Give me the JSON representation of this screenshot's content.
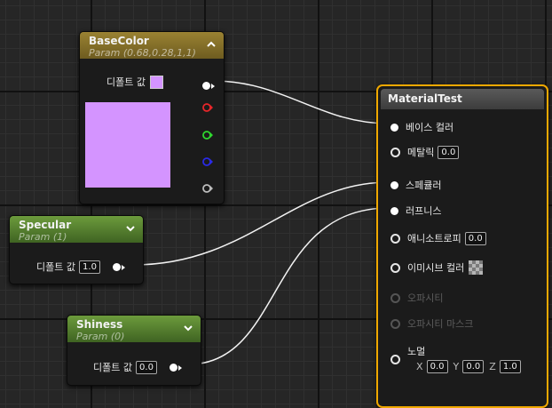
{
  "nodes": {
    "basecolor": {
      "title": "BaseColor",
      "subtitle": "Param (0.68,0.28,1,1)",
      "default_label": "디폴트 값",
      "color": "#d494ff"
    },
    "specular": {
      "title": "Specular",
      "subtitle": "Param (1)",
      "default_label": "디폴트 값",
      "value": "1.0"
    },
    "shiness": {
      "title": "Shiness",
      "subtitle": "Param (0)",
      "default_label": "디폴트 값",
      "value": "0.0"
    },
    "material": {
      "title": "MaterialTest",
      "pins": {
        "base_color": "베이스 컬러",
        "metallic": "메탈릭",
        "metallic_value": "0.0",
        "specular": "스페큘러",
        "roughness": "러프니스",
        "anisotropy": "애니소트로피",
        "anisotropy_value": "0.0",
        "emissive": "이미시브 컬러",
        "opacity": "오파시티",
        "opacity_mask": "오파시티 마스크",
        "normal": "노멀",
        "normal_x_label": "X",
        "normal_x": "0.0",
        "normal_y_label": "Y",
        "normal_y": "0.0",
        "normal_z_label": "Z",
        "normal_z": "1.0"
      }
    }
  },
  "colors": {
    "channel_red": "#e8262a",
    "channel_green": "#2fd82f",
    "channel_blue": "#2a2ae6",
    "channel_alpha": "#bdbdbd",
    "selection_outline": "#f0a800",
    "param_header": "#9a8232",
    "scalar_header": "#6c9b3c"
  },
  "icons": [
    "collapse-chevron-icon",
    "expand-chevron-icon",
    "output-pin-icon",
    "input-pin-icon"
  ]
}
